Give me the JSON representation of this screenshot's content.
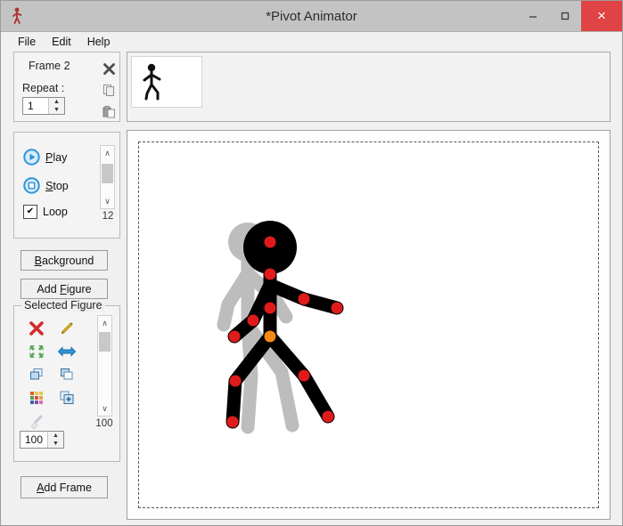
{
  "window": {
    "title": "*Pivot Animator",
    "app_icon": "stick-figure-icon",
    "minimize_label": "─",
    "maximize_label": "☐",
    "close_label": "×"
  },
  "menubar": {
    "items": [
      {
        "label": "File"
      },
      {
        "label": "Edit"
      },
      {
        "label": "Help"
      }
    ]
  },
  "frame_panel": {
    "frame_label": "Frame 2",
    "repeat_label": "Repeat :",
    "repeat_value": "1",
    "spin_up": "▲",
    "spin_down": "▼",
    "tools": [
      {
        "name": "delete-frame-icon",
        "glyph": "✖"
      },
      {
        "name": "copy-frame-icon",
        "glyph": "⧉"
      },
      {
        "name": "paste-frame-icon",
        "glyph": "⧉"
      }
    ]
  },
  "frames_list": {
    "thumbnail_alt": "frame-1-thumbnail"
  },
  "playback": {
    "play_label": "Play",
    "stop_label": "Stop",
    "loop_label": "Loop",
    "loop_checked": true,
    "check_glyph": "✔",
    "speed_value": "12",
    "scroll_up": "∧",
    "scroll_down": "∨"
  },
  "buttons": {
    "background_label": "Background",
    "add_figure_label": "Add Figure",
    "add_frame_label": "Add Frame"
  },
  "selected_figure": {
    "group_title": "Selected Figure",
    "opacity_value": "100",
    "scroll_value": "100",
    "scroll_up": "∧",
    "scroll_down": "∨",
    "spin_up": "▲",
    "spin_down": "▼",
    "icons": [
      {
        "name": "delete-figure-icon",
        "tip": "Delete figure"
      },
      {
        "name": "edit-figure-icon",
        "tip": "Edit figure"
      },
      {
        "name": "resize-figure-icon",
        "tip": "Resize figure"
      },
      {
        "name": "flip-figure-icon",
        "tip": "Flip figure"
      },
      {
        "name": "bring-to-front-icon",
        "tip": "Bring to front"
      },
      {
        "name": "send-to-back-icon",
        "tip": "Send to back"
      },
      {
        "name": "figure-colour-icon",
        "tip": "Figure colour"
      },
      {
        "name": "duplicate-figure-icon",
        "tip": "Duplicate figure"
      },
      {
        "name": "eyedropper-icon",
        "tip": "Pick colour",
        "disabled": true
      }
    ]
  },
  "canvas": {
    "name": "animation-canvas",
    "figure": {
      "line_color": "#000000",
      "joint_color": "#e01b1b",
      "root_joint_color": "#f58a13",
      "onion_skin_color": "#bdbdbd"
    }
  },
  "colors": {
    "titlebar": "#c3c3c3",
    "close_button": "#e04343",
    "panel": "#f0f0f0",
    "accent_blue": "#2f94d8"
  }
}
